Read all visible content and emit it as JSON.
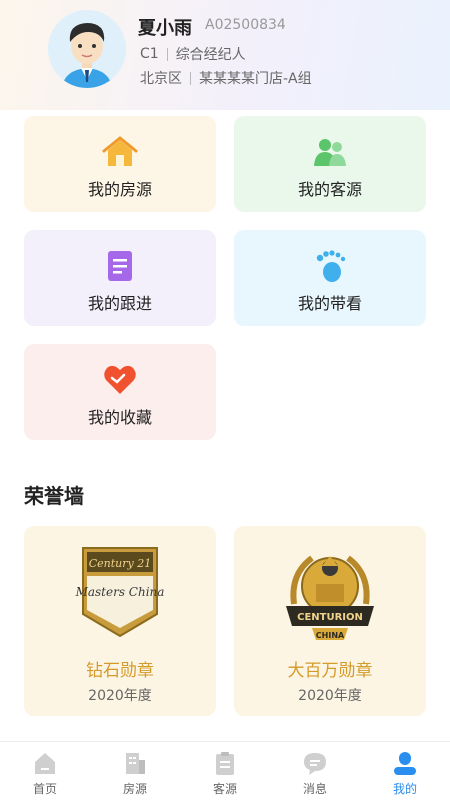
{
  "profile": {
    "name": "夏小雨",
    "code": "A02500834",
    "level": "C1",
    "role": "综合经纪人",
    "district": "北京区",
    "store": "某某某某门店-A组"
  },
  "menu": {
    "items": [
      {
        "label": "我的房源",
        "icon": "house-icon"
      },
      {
        "label": "我的客源",
        "icon": "clients-icon"
      },
      {
        "label": "我的跟进",
        "icon": "document-icon"
      },
      {
        "label": "我的带看",
        "icon": "footprint-icon"
      },
      {
        "label": "我的收藏",
        "icon": "heart-icon"
      }
    ]
  },
  "honor": {
    "title": "荣誉墙",
    "medals": [
      {
        "name": "钻石勋章",
        "year": "2020年度",
        "badge_text_1": "Century 21",
        "badge_text_2": "Masters China"
      },
      {
        "name": "大百万勋章",
        "year": "2020年度",
        "badge_text_1": "CENTURION",
        "badge_text_2": "CHINA"
      }
    ]
  },
  "tabs": [
    {
      "label": "首页",
      "icon": "home-icon"
    },
    {
      "label": "房源",
      "icon": "building-icon"
    },
    {
      "label": "客源",
      "icon": "clipboard-icon"
    },
    {
      "label": "消息",
      "icon": "message-icon"
    },
    {
      "label": "我的",
      "icon": "person-icon",
      "active": true
    }
  ],
  "colors": {
    "accent": "#2a8ef0",
    "medal_text": "#d49a2a"
  }
}
